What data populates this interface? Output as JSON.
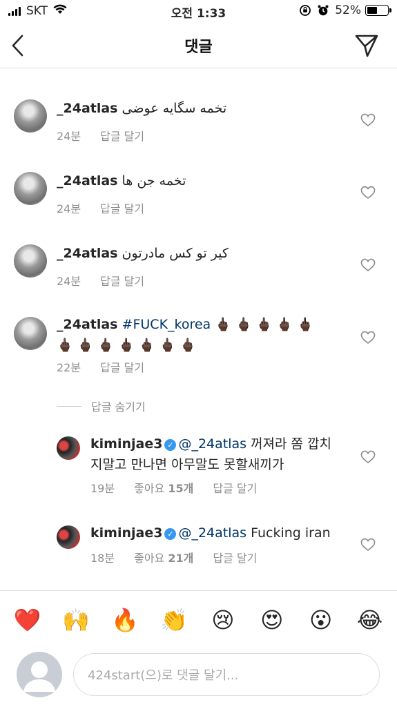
{
  "status_bar": {
    "carrier": "SKT",
    "time": "오전 1:33",
    "battery": "52%",
    "battery_level": 0.52
  },
  "nav": {
    "title": "댓글",
    "back_icon": "chevron-left-icon",
    "send_icon": "paper-plane-icon"
  },
  "comments": [
    {
      "username": "_24atlas",
      "text": "تخمه سگایه عوضی",
      "time": "24분",
      "reply": "답글 달기"
    },
    {
      "username": "_24atlas",
      "text": "تخمه جن ها",
      "time": "24분",
      "reply": "답글 달기"
    },
    {
      "username": "_24atlas",
      "text": "کیر تو کس مادرتون",
      "time": "24분",
      "reply": "답글 달기"
    },
    {
      "username": "_24atlas",
      "hashtag": "#FUCK_korea",
      "emoji_line1": "🖕🏿 🖕🏿 🖕🏿 🖕🏿 🖕🏿",
      "emoji_line2": "🖕🏿 🖕🏿 🖕🏿 🖕🏿 🖕🏿 🖕🏿 🖕🏿",
      "time": "22분",
      "reply": "답글 달기"
    }
  ],
  "hide_replies": "답글 숨기기",
  "replies": [
    {
      "username": "kiminjae3",
      "mention": "@_24atlas",
      "text_line1": "꺼져라 쫌 깝치",
      "text_line2": "지말고 만나면 아무말도 못할새끼가",
      "time": "19분",
      "likes_label": "좋아요",
      "likes_count": "15개",
      "reply": "답글 달기"
    },
    {
      "username": "kiminjae3",
      "mention": "@_24atlas",
      "text_line1": "Fucking iran",
      "time": "18분",
      "likes_label": "좋아요",
      "likes_count": "21개",
      "reply": "답글 달기"
    }
  ],
  "emoji_bar": [
    "❤️",
    "🙌",
    "🔥",
    "👏",
    "😢",
    "😍",
    "😮",
    "😂"
  ],
  "composer": {
    "placeholder": "424start(으)로 댓글 달기..."
  }
}
